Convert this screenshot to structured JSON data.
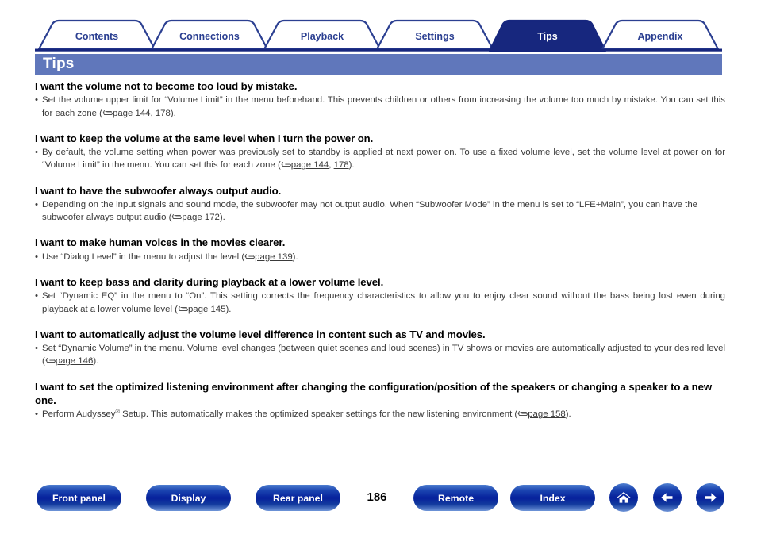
{
  "tabs": [
    {
      "label": "Contents",
      "active": false
    },
    {
      "label": "Connections",
      "active": false
    },
    {
      "label": "Playback",
      "active": false
    },
    {
      "label": "Settings",
      "active": false
    },
    {
      "label": "Tips",
      "active": true
    },
    {
      "label": "Appendix",
      "active": false
    }
  ],
  "title": "Tips",
  "tips": [
    {
      "heading": "I want the volume not to become too loud by mistake.",
      "body_pre": "Set the volume upper limit for “Volume Limit” in the menu beforehand. This prevents children or others from increasing the volume too much by mistake. You can set this for each zone (",
      "links": [
        "page 144",
        "178"
      ],
      "body_post": ")."
    },
    {
      "heading": "I want to keep the volume at the same level when I turn the power on.",
      "body_pre": "By default, the volume setting when power was previously set to standby is applied at next power on. To use a fixed volume level, set the volume level at power on for “Volume Limit” in the menu. You can set this for each zone (",
      "links": [
        "page 144",
        "178"
      ],
      "body_post": ")."
    },
    {
      "heading": "I want to have the subwoofer always output audio.",
      "body_pre": "Depending on the input signals and sound mode, the subwoofer may not output audio. When “Subwoofer Mode” in the menu is set to “LFE+Main”, you can have the subwoofer always output audio (",
      "links": [
        "page 172"
      ],
      "body_post": ")."
    },
    {
      "heading": "I want to make human voices in the movies clearer.",
      "body_pre": "Use “Dialog Level” in the menu to adjust the level (",
      "links": [
        "page 139"
      ],
      "body_post": ")."
    },
    {
      "heading": "I want to keep bass and clarity during playback at a lower volume level.",
      "body_pre": "Set “Dynamic EQ” in the menu to “On”. This setting corrects the frequency characteristics to allow you to enjoy clear sound without the bass being lost even during playback at a lower volume level (",
      "links": [
        "page 145"
      ],
      "body_post": ")."
    },
    {
      "heading": "I want to automatically adjust the volume level difference in content such as TV and movies.",
      "body_pre": "Set “Dynamic Volume” in the menu. Volume level changes (between quiet scenes and loud scenes) in TV shows or movies are automatically adjusted to your desired level (",
      "links": [
        "page 146"
      ],
      "body_post": ")."
    },
    {
      "heading": "I want to set the optimized listening environment after changing the configuration/position of the speakers or changing a speaker to a new one.",
      "body_pre": "Perform Audyssey® Setup. This automatically makes the optimized speaker settings for the new listening environment (",
      "links": [
        "page 158"
      ],
      "body_post": ")."
    }
  ],
  "footer": {
    "buttons": [
      {
        "label": "Front panel"
      },
      {
        "label": "Display"
      },
      {
        "label": "Rear panel"
      },
      {
        "label": "Remote"
      },
      {
        "label": "Index"
      }
    ],
    "page_number": "186",
    "icons": [
      {
        "name": "home-icon"
      },
      {
        "name": "arrow-left-icon"
      },
      {
        "name": "arrow-right-icon"
      }
    ]
  },
  "colors": {
    "tab_active_bg": "#17277e",
    "tab_border": "#2b3f91",
    "title_bar_bg": "#6077bb",
    "button_blue": "#06209b"
  }
}
